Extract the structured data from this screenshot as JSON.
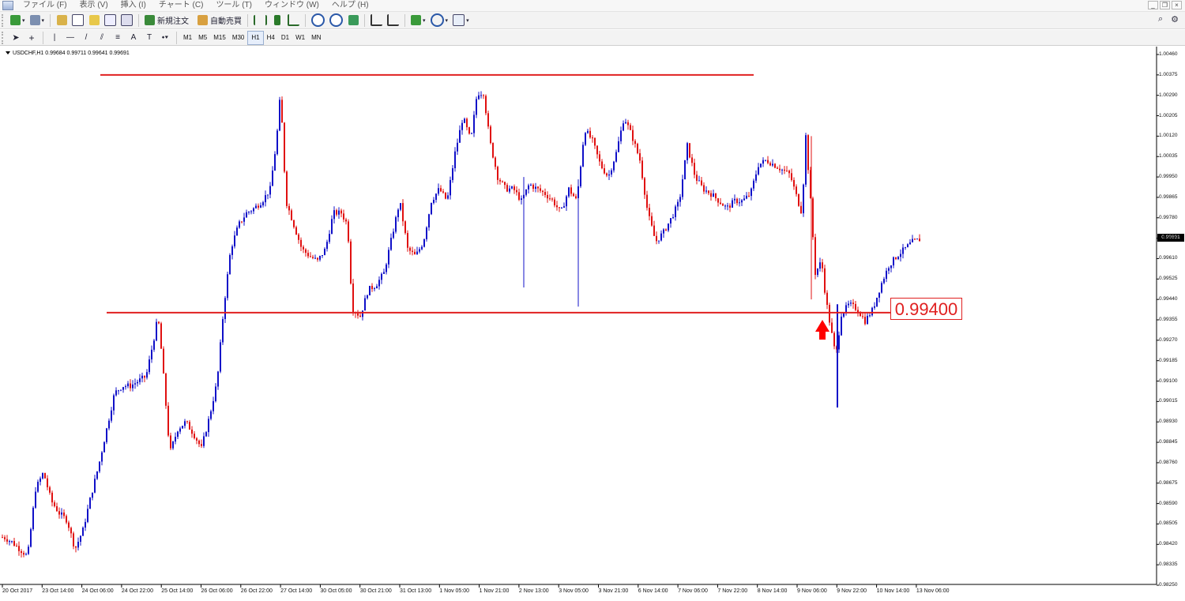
{
  "menu": [
    "ファイル (F)",
    "表示 (V)",
    "挿入 (I)",
    "チャート (C)",
    "ツール (T)",
    "ウィンドウ (W)",
    "ヘルプ (H)"
  ],
  "toolbar": {
    "new_order": "新規注文",
    "auto_trade": "自動売買"
  },
  "timeframes": [
    "M1",
    "M5",
    "M15",
    "M30",
    "H1",
    "H4",
    "D1",
    "W1",
    "MN"
  ],
  "active_timeframe": "H1",
  "chart": {
    "title": "USDCHF,H1  0.99684 0.99711 0.99641 0.99691",
    "current_price": "0.99691",
    "annotation_price": "0.99400",
    "bull_color": "#1010c8",
    "bear_color": "#e01010",
    "line_color": "#e02020"
  },
  "chart_data": {
    "type": "candlestick",
    "symbol": "USDCHF",
    "timeframe": "H1",
    "ohlc": {
      "open": 0.99684,
      "high": 0.99711,
      "low": 0.99641,
      "close": 0.99691
    },
    "y_ticks": [
      "1.00460",
      "1.00375",
      "1.00290",
      "1.00205",
      "1.00120",
      "1.00035",
      "0.99950",
      "0.99865",
      "0.99780",
      "0.99695",
      "0.99610",
      "0.99525",
      "0.99440",
      "0.99355",
      "0.99270",
      "0.99185",
      "0.99100",
      "0.99015",
      "0.98930",
      "0.98845",
      "0.98760",
      "0.98675",
      "0.98590",
      "0.98505",
      "0.98420",
      "0.98335",
      "0.98250"
    ],
    "ylim": [
      0.9825,
      1.0046
    ],
    "x_ticks": [
      "20 Oct 2017",
      "23 Oct 14:00",
      "24 Oct 06:00",
      "24 Oct 22:00",
      "25 Oct 14:00",
      "26 Oct 06:00",
      "26 Oct 22:00",
      "27 Oct 14:00",
      "30 Oct 05:00",
      "30 Oct 21:00",
      "31 Oct 13:00",
      "1 Nov 05:00",
      "1 Nov 21:00",
      "2 Nov 13:00",
      "3 Nov 05:00",
      "3 Nov 21:00",
      "6 Nov 14:00",
      "7 Nov 06:00",
      "7 Nov 22:00",
      "8 Nov 14:00",
      "9 Nov 06:00",
      "9 Nov 22:00",
      "10 Nov 14:00",
      "13 Nov 06:00"
    ],
    "horizontal_lines": [
      1.00375,
      0.99385,
      0.99385
    ],
    "path": [
      [
        0,
        0.9845
      ],
      [
        5,
        0.9845
      ],
      [
        15,
        0.9843
      ],
      [
        25,
        0.984
      ],
      [
        35,
        0.9837
      ],
      [
        45,
        0.9865
      ],
      [
        55,
        0.9872
      ],
      [
        65,
        0.986
      ],
      [
        75,
        0.9855
      ],
      [
        85,
        0.9852
      ],
      [
        95,
        0.984
      ],
      [
        105,
        0.9848
      ],
      [
        115,
        0.9862
      ],
      [
        125,
        0.9875
      ],
      [
        135,
        0.989
      ],
      [
        145,
        0.9905
      ],
      [
        155,
        0.9908
      ],
      [
        165,
        0.9908
      ],
      [
        175,
        0.991
      ],
      [
        185,
        0.9912
      ],
      [
        195,
        0.9928
      ],
      [
        200,
        0.9937
      ],
      [
        205,
        0.992
      ],
      [
        215,
        0.988
      ],
      [
        225,
        0.989
      ],
      [
        235,
        0.9893
      ],
      [
        245,
        0.9888
      ],
      [
        255,
        0.9882
      ],
      [
        265,
        0.9895
      ],
      [
        275,
        0.991
      ],
      [
        283,
        0.994
      ],
      [
        292,
        0.9965
      ],
      [
        302,
        0.9975
      ],
      [
        312,
        0.998
      ],
      [
        322,
        0.9982
      ],
      [
        332,
        0.9985
      ],
      [
        342,
        0.999
      ],
      [
        350,
        1.001
      ],
      [
        355,
        1.003
      ],
      [
        362,
        0.9985
      ],
      [
        372,
        0.9975
      ],
      [
        382,
        0.9965
      ],
      [
        392,
        0.9962
      ],
      [
        402,
        0.996
      ],
      [
        412,
        0.9965
      ],
      [
        422,
        0.998
      ],
      [
        432,
        0.998
      ],
      [
        440,
        0.9975
      ],
      [
        446,
        0.994
      ],
      [
        456,
        0.9937
      ],
      [
        466,
        0.9948
      ],
      [
        476,
        0.995
      ],
      [
        486,
        0.9955
      ],
      [
        496,
        0.997
      ],
      [
        506,
        0.9985
      ],
      [
        516,
        0.9965
      ],
      [
        526,
        0.9962
      ],
      [
        536,
        0.9968
      ],
      [
        546,
        0.9985
      ],
      [
        556,
        0.999
      ],
      [
        566,
        0.9985
      ],
      [
        576,
        1.0005
      ],
      [
        586,
        1.002
      ],
      [
        596,
        1.001
      ],
      [
        604,
        1.003
      ],
      [
        612,
        1.003
      ],
      [
        620,
        1.001
      ],
      [
        630,
        0.9995
      ],
      [
        640,
        0.999
      ],
      [
        650,
        0.999
      ],
      [
        660,
        0.9985
      ],
      [
        670,
        0.9992
      ],
      [
        680,
        0.999
      ],
      [
        690,
        0.9988
      ],
      [
        700,
        0.9985
      ],
      [
        710,
        0.998
      ],
      [
        720,
        0.999
      ],
      [
        730,
        0.9985
      ],
      [
        740,
        1.0015
      ],
      [
        750,
        1.001
      ],
      [
        760,
        1.0
      ],
      [
        770,
        0.9995
      ],
      [
        780,
        1.0005
      ],
      [
        790,
        1.002
      ],
      [
        800,
        1.0012
      ],
      [
        810,
        1.0002
      ],
      [
        820,
        0.998
      ],
      [
        830,
        0.9968
      ],
      [
        840,
        0.9972
      ],
      [
        850,
        0.9978
      ],
      [
        860,
        0.9985
      ],
      [
        870,
        1.0008
      ],
      [
        880,
        0.9995
      ],
      [
        890,
        0.999
      ],
      [
        900,
        0.9988
      ],
      [
        910,
        0.9985
      ],
      [
        920,
        0.9982
      ],
      [
        930,
        0.9985
      ],
      [
        940,
        0.9985
      ],
      [
        950,
        0.9988
      ],
      [
        960,
        1.0
      ],
      [
        970,
        1.0002
      ],
      [
        980,
        1.0
      ],
      [
        990,
        0.9998
      ],
      [
        1000,
        0.9996
      ],
      [
        1010,
        0.9985
      ],
      [
        1015,
        0.998
      ],
      [
        1020,
        1.0012
      ],
      [
        1025,
        0.999
      ],
      [
        1032,
        0.9955
      ],
      [
        1040,
        0.996
      ],
      [
        1045,
        0.9945
      ],
      [
        1050,
        0.9935
      ],
      [
        1058,
        0.992
      ],
      [
        1065,
        0.9938
      ],
      [
        1075,
        0.9942
      ],
      [
        1085,
        0.994
      ],
      [
        1095,
        0.9935
      ],
      [
        1105,
        0.994
      ],
      [
        1115,
        0.995
      ],
      [
        1125,
        0.9958
      ],
      [
        1135,
        0.9962
      ],
      [
        1145,
        0.9965
      ],
      [
        1155,
        0.9968
      ],
      [
        1165,
        0.9969
      ]
    ]
  },
  "right_icons": {
    "search": "⌕",
    "settings": "⚙"
  }
}
